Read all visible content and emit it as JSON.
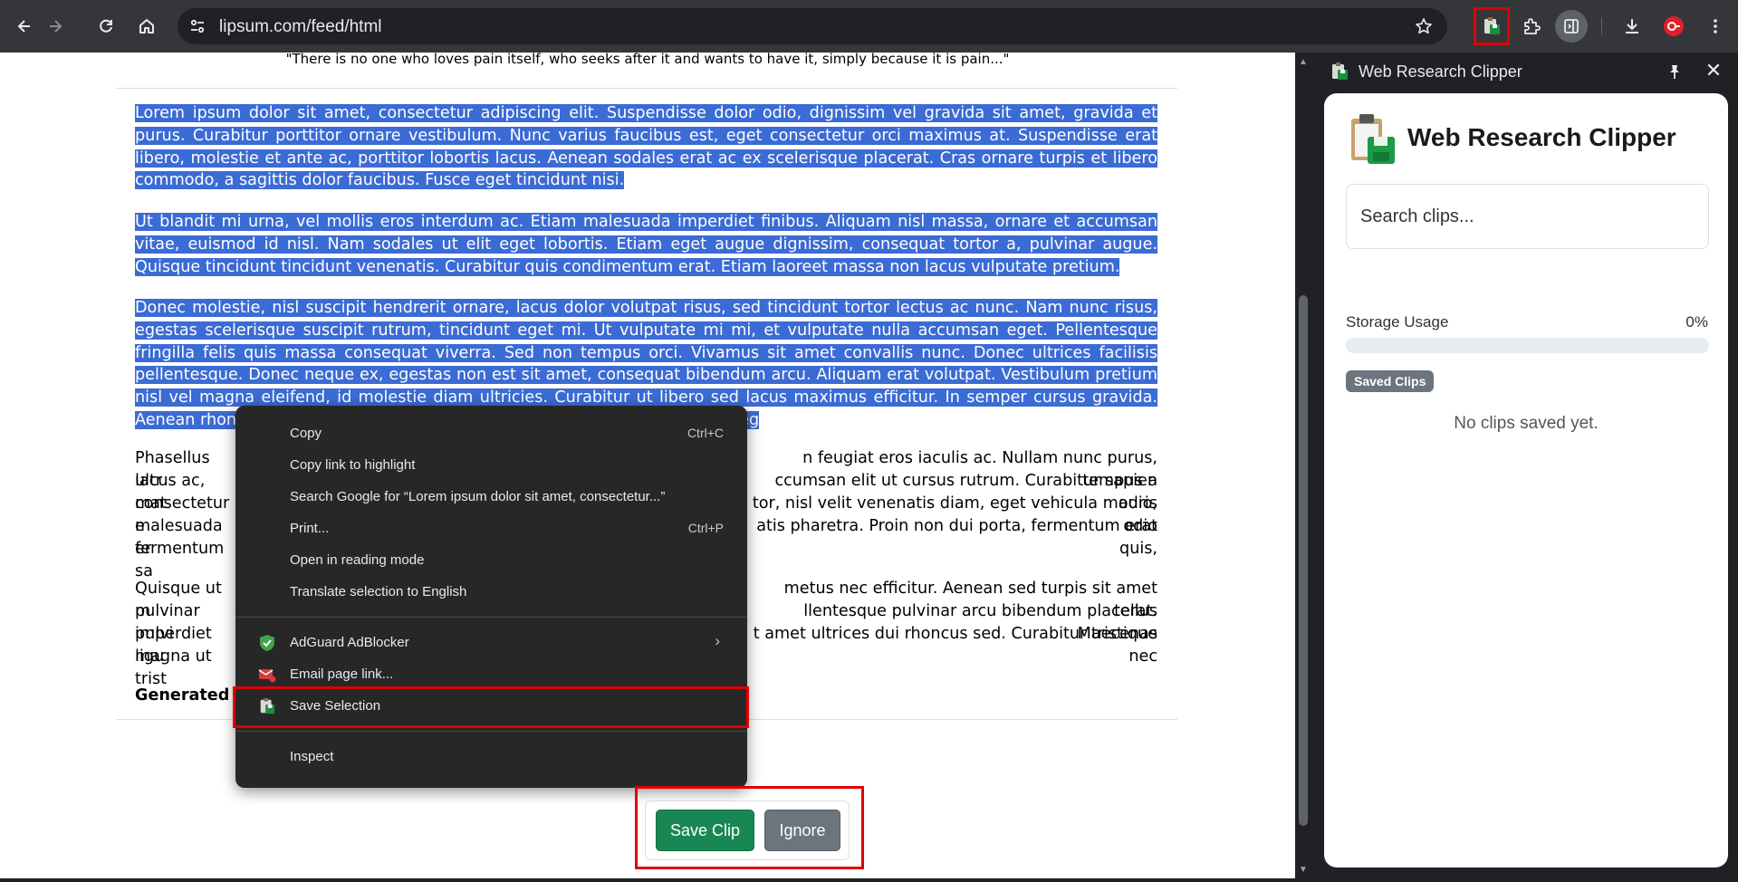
{
  "browser": {
    "url": "lipsum.com/feed/html",
    "toolbar_icons": [
      "back-icon",
      "forward-icon",
      "reload-icon",
      "home-icon",
      "site-info-icon",
      "bookmark-star-icon",
      "web-research-clipper-extension-icon",
      "extensions-puzzle-icon",
      "side-panel-icon",
      "download-icon",
      "profile-avatar-icon",
      "more-menu-icon"
    ]
  },
  "page": {
    "quote": "\"There is no one who loves pain itself, who seeks after it and wants to have it, simply because it is pain...\"",
    "selected_paragraphs": [
      "Lorem ipsum dolor sit amet, consectetur adipiscing elit. Suspendisse dolor odio, dignissim vel gravida sit amet, gravida et purus. Curabitur porttitor ornare vestibulum. Nunc varius faucibus est, eget consectetur orci maximus at. Suspendisse erat libero, molestie et ante ac, porttitor lobortis lacus. Aenean sodales erat ac ex scelerisque placerat. Cras ornare turpis et libero commodo, a sagittis dolor faucibus. Fusce eget tincidunt nisi.",
      "Ut blandit mi urna, vel mollis eros interdum ac. Etiam malesuada imperdiet finibus. Aliquam nisl massa, ornare et accumsan vitae, euismod id nisl. Nam sodales ut elit eget lobortis. Etiam eget augue dignissim, consequat tortor a, pulvinar augue. Quisque tincidunt tincidunt venenatis. Curabitur quis condimentum erat. Etiam laoreet massa non lacus vulputate pretium.",
      "Donec molestie, nisl suscipit hendrerit ornare, lacus dolor volutpat risus, sed tincidunt tortor lectus ac nunc. Nam nunc risus, egestas scelerisque suscipit rutrum, tincidunt eget mi. Ut vulputate mi mi, et vulputate nulla accumsan eget. Pellentesque fringilla felis quis massa consequat viverra. Sed non tempus orci. Vivamus sit amet convallis nunc. Donec ultrices facilisis pellentesque. Donec neque ex, egestas non est sit amet, consequat bibendum arcu. Aliquam erat volutpat. Vestibulum pretium nisl vel magna eleifend, id molestie diam ultricies. Curabitur ut libero sed lacus maximus efficitur. In semper cursus gravida. Aenean rhoncus eu augue vel congue. Sed laoreet odio quis elit gravida, id eg"
    ],
    "para4_visible": [
      "Phasellus ultr",
      "n feugiat eros iaculis ac. Nullam nunc purus, tempus a",
      "lacus ac, mat",
      "ccumsan elit ut cursus rutrum. Curabitur sapien odio,",
      "consectetur e",
      "tor, nisl velit venenatis diam, eget vehicula mauris odio",
      "malesuada er",
      "atis pharetra. Proin non dui porta, fermentum erat quis,",
      "fermentum sa"
    ],
    "para5_visible": [
      "Quisque ut m",
      "metus nec efficitur. Aenean sed turpis sit amet tellus",
      "pulvinar pulvi",
      "llentesque pulvinar arcu bibendum placerat. Maecenas",
      "imperdiet ligu",
      "t amet ultrices dui rhoncus sed. Curabitur tristique nec",
      "magna ut trist"
    ],
    "generated": "Generated 5"
  },
  "context_menu": {
    "copy": "Copy",
    "copy_shortcut": "Ctrl+C",
    "copy_link": "Copy link to highlight",
    "search_google": "Search Google for “Lorem ipsum dolor sit amet, consectetur...”",
    "print": "Print...",
    "print_shortcut": "Ctrl+P",
    "reading_mode": "Open in reading mode",
    "translate": "Translate selection to English",
    "adguard": "AdGuard AdBlocker",
    "email": "Email page link...",
    "save_selection": "Save Selection",
    "inspect": "Inspect"
  },
  "side_panel": {
    "title": "Web Research Clipper",
    "heading": "Web Research Clipper",
    "search_placeholder": "Search clips...",
    "storage_label": "Storage Usage",
    "storage_percent": "0%",
    "storage_fraction": 0,
    "saved_clips_badge": "Saved Clips",
    "empty_message": "No clips saved yet."
  },
  "clip_actions": {
    "save": "Save Clip",
    "ignore": "Ignore"
  },
  "colors": {
    "selection": "#3b6bd4",
    "save_green": "#198754",
    "ignore_gray": "#6c757d",
    "highlight_red": "#e00000",
    "menu_bg": "#272727",
    "toolbar_bg": "#35363a"
  }
}
